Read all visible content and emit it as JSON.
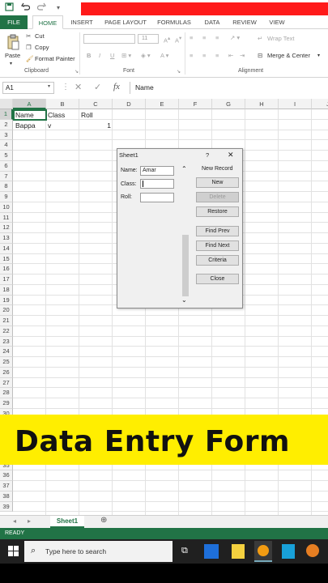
{
  "app": {
    "tabs": [
      "FILE",
      "HOME",
      "INSERT",
      "PAGE LAYOUT",
      "FORMULAS",
      "DATA",
      "REVIEW",
      "VIEW"
    ]
  },
  "ribbon": {
    "paste": "Paste",
    "cut": "Cut",
    "copy": "Copy",
    "format_painter": "Format Painter",
    "clipboard": "Clipboard",
    "font_size": "11",
    "font_group": "Font",
    "bold": "B",
    "italic": "I",
    "underline": "U",
    "wrap_text": "Wrap Text",
    "merge_center": "Merge & Center",
    "alignment": "Alignment"
  },
  "formula_bar": {
    "name_box": "A1",
    "fx": "fx",
    "value": "Name"
  },
  "grid": {
    "columns": [
      "A",
      "B",
      "C",
      "D",
      "E",
      "F",
      "G",
      "H",
      "I",
      "J"
    ],
    "rows": [
      "1",
      "2",
      "3",
      "4",
      "5",
      "6",
      "7",
      "8",
      "9",
      "10",
      "11",
      "12",
      "13",
      "14",
      "15",
      "16",
      "17",
      "18",
      "19",
      "20",
      "21",
      "22",
      "23",
      "24",
      "25",
      "26",
      "27",
      "28",
      "29",
      "30",
      "31",
      "32",
      "33",
      "34",
      "35",
      "36",
      "37",
      "38",
      "39"
    ],
    "a1": "Name",
    "b1": "Class",
    "c1": "Roll",
    "a2": "Bappa",
    "b2": "v",
    "c2": "1"
  },
  "dialog": {
    "title": "Sheet1",
    "help": "?",
    "close_x": "✕",
    "record_status": "New Record",
    "name_label": "Name:",
    "name_value": "Amar",
    "class_label": "Class:",
    "class_value": "",
    "roll_label": "Roll:",
    "roll_value": "",
    "buttons": {
      "new": "New",
      "delete": "Delete",
      "restore": "Restore",
      "find_prev": "Find Prev",
      "find_next": "Find Next",
      "criteria": "Criteria",
      "close": "Close"
    }
  },
  "banner": {
    "text": "Data Entry Form",
    "color": "#ffee00"
  },
  "sheet_tabs": {
    "active": "Sheet1"
  },
  "status": {
    "text": "READY"
  },
  "taskbar": {
    "search_placeholder": "Type here to search"
  },
  "colors": {
    "excel_green": "#217346",
    "red_bar": "#ff1a1a"
  }
}
